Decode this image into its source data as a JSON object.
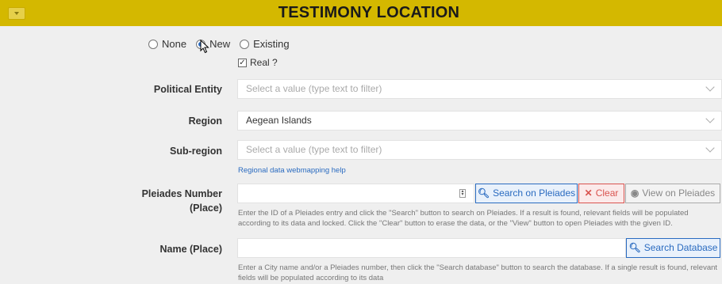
{
  "header": {
    "title": "TESTIMONY LOCATION"
  },
  "radios": [
    {
      "label": "None",
      "selected": false
    },
    {
      "label": "New",
      "selected": true
    },
    {
      "label": "Existing",
      "selected": false
    }
  ],
  "real_checkbox": {
    "label": "Real ?",
    "checked": true
  },
  "political_entity": {
    "label": "Political Entity",
    "placeholder": "Select a value (type text to filter)"
  },
  "region": {
    "label": "Region",
    "value": "Aegean Islands"
  },
  "subregion": {
    "label": "Sub-region",
    "placeholder": "Select a value (type text to filter)"
  },
  "help_link": "Regional data webmapping help",
  "pleiades": {
    "label_line1": "Pleiades Number",
    "label_line2": "(Place)",
    "search_label": "Search on Pleiades",
    "clear_label": "Clear",
    "view_label": "View on Pleiades",
    "help": "Enter the ID of a Pleiades entry and click the \"Search\" button to search on Pleiades. If a result is found, relevant fields will be populated according to its data and locked. Click the \"Clear\" button to erase the data, or the \"View\" button to open Pleiades with the given ID."
  },
  "name_place": {
    "label": "Name (Place)",
    "search_label": "Search Database",
    "help": "Enter a City name and/or a Pleiades number, then click the \"Search database\" button to search the database. If a single result is found, relevant fields will be populated according to its data"
  },
  "colors": {
    "header": "#d4b800",
    "accent": "#2a6bc0",
    "danger": "#d9534f"
  }
}
